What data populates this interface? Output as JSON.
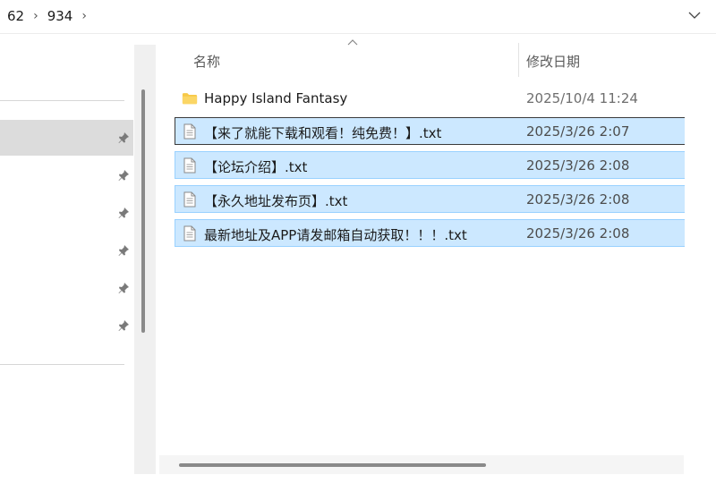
{
  "breadcrumb": {
    "items": [
      "62",
      "934"
    ],
    "separator": "›"
  },
  "icons": {
    "breadcrumb_separator": "chevron-right-icon",
    "expand": "chevron-down-icon",
    "pin": "pin-icon",
    "folder": "folder-icon",
    "file": "text-file-icon",
    "sort": "sort-ascending-icon"
  },
  "columns": {
    "name": "名称",
    "date": "修改日期"
  },
  "files": [
    {
      "name": "Happy Island Fantasy",
      "date": "2025/10/4 11:24",
      "type": "folder",
      "selected": false
    },
    {
      "name": "【来了就能下载和观看！纯免费！】.txt",
      "date": "2025/3/26 2:07",
      "type": "file",
      "selected": true
    },
    {
      "name": "【论坛介绍】.txt",
      "date": "2025/3/26 2:08",
      "type": "file",
      "selected": true
    },
    {
      "name": "【永久地址发布页】.txt",
      "date": "2025/3/26 2:08",
      "type": "file",
      "selected": true
    },
    {
      "name": "最新地址及APP请发邮箱自动获取！！！.txt",
      "date": "2025/3/26 2:08",
      "type": "file",
      "selected": true
    }
  ],
  "colors": {
    "selection_bg": "#cce8ff",
    "selection_border": "#99d1ff",
    "folder_yellow": "#f7c948"
  }
}
